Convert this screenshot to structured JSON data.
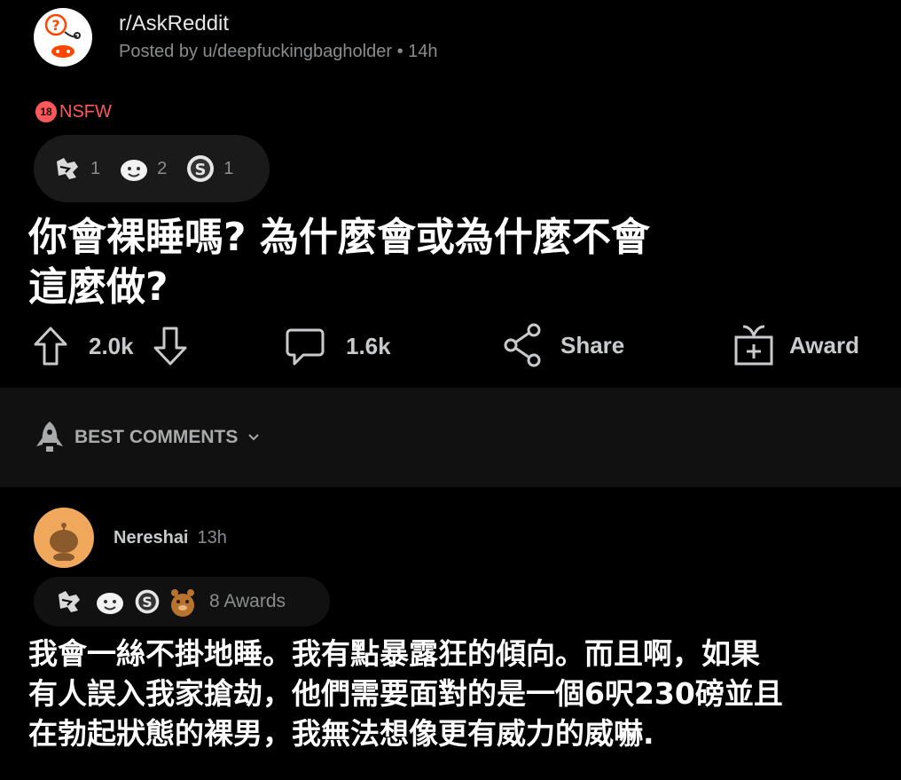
{
  "post": {
    "subreddit": "r/AskReddit",
    "posted_by": "Posted by u/deepfuckingbagholder • 14h",
    "nsfw_badge": "18",
    "nsfw_label": "NSFW",
    "awards": [
      {
        "icon": "helpful-hand-award-icon",
        "count": "1"
      },
      {
        "icon": "wholesome-award-icon",
        "count": "2"
      },
      {
        "icon": "silver-award-icon",
        "count": "1"
      }
    ],
    "title": "你會裸睡嗎? 為什麼會或為什麼不會\n這麼做?",
    "votes": "2.0k",
    "comments": "1.6k",
    "share_label": "Share",
    "award_label": "Award"
  },
  "sort": {
    "label": "BEST COMMENTS"
  },
  "comment": {
    "username": "Nereshai",
    "time": "13h",
    "awards_count_label": "8 Awards",
    "body": "我會一絲不掛地睡。我有點暴露狂的傾向。而且啊，如果\n有人誤入我家搶劫，他們需要面對的是一個6呎230磅並且\n在勃起狀態的裸男，我無法想像更有威力的威嚇."
  },
  "colors": {
    "background": "#000000",
    "nsfw": "#ff585b",
    "pill": "#1a1a1b",
    "sort_bar": "#111111",
    "avatar_orange": "#f0a95c"
  }
}
